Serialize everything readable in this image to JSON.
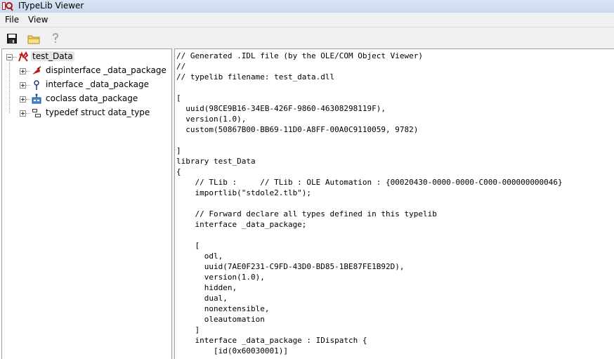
{
  "window": {
    "title": "ITypeLib Viewer",
    "title_icon": "oleview-app-icon"
  },
  "menu": [
    {
      "label": "File"
    },
    {
      "label": "View"
    }
  ],
  "toolbar": [
    {
      "name": "save-button",
      "icon": "floppy-disk-icon"
    },
    {
      "name": "open-button",
      "icon": "folder-icon"
    },
    {
      "name": "help-button",
      "icon": "help-question-icon"
    }
  ],
  "tree": {
    "root": {
      "label": "test_Data",
      "icon": "typelib-icon",
      "expanded": true
    },
    "children": [
      {
        "label": "dispinterface _data_package",
        "icon": "dispinterface-icon"
      },
      {
        "label": "interface _data_package",
        "icon": "interface-icon"
      },
      {
        "label": "coclass data_package",
        "icon": "coclass-icon"
      },
      {
        "label": "typedef struct data_type",
        "icon": "struct-icon"
      }
    ]
  },
  "code_lines": [
    "// Generated .IDL file (by the OLE/COM Object Viewer)",
    "//",
    "// typelib filename: test_data.dll",
    "",
    "[",
    "  uuid(98CE9B16-34EB-426F-9860-46308298119F),",
    "  version(1.0),",
    "  custom(50867B00-BB69-11D0-A8FF-00A0C9110059, 9782)",
    "",
    "]",
    "library test_Data",
    "{",
    "    // TLib :     // TLib : OLE Automation : {00020430-0000-0000-C000-000000000046}",
    "    importlib(\"stdole2.tlb\");",
    "",
    "    // Forward declare all types defined in this typelib",
    "    interface _data_package;",
    "",
    "    [",
    "      odl,",
    "      uuid(7AE0F231-C9FD-43D0-BD85-1BE87FE1B92D),",
    "      version(1.0),",
    "      hidden,",
    "      dual,",
    "      nonextensible,",
    "      oleautomation",
    "    ]",
    "    interface _data_package : IDispatch {",
    "        [id(0x60030001)]"
  ]
}
